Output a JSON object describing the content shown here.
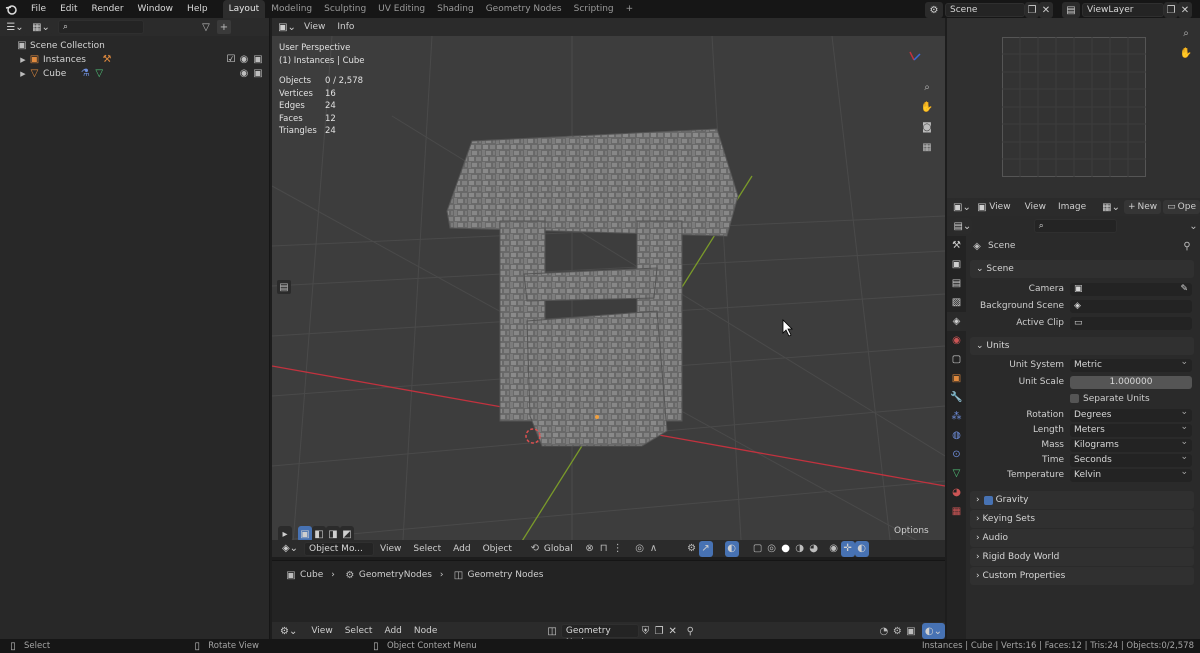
{
  "menu": [
    "File",
    "Edit",
    "Render",
    "Window",
    "Help"
  ],
  "workspaces": [
    "Layout",
    "Modeling",
    "Sculpting",
    "UV Editing",
    "Shading",
    "Geometry Nodes",
    "Scripting"
  ],
  "add_tab": "+",
  "scene_field": "Scene",
  "viewlayer_field": "ViewLayer",
  "outliner": {
    "root": "Scene Collection",
    "items": [
      {
        "label": "Instances"
      },
      {
        "label": "Cube"
      }
    ]
  },
  "viewport_header": {
    "view": "View",
    "info": "Info"
  },
  "viewport": {
    "perspective": "User Perspective",
    "selection": "(1) Instances | Cube",
    "stats": [
      {
        "k": "Objects",
        "v": "0 / 2,578"
      },
      {
        "k": "Vertices",
        "v": "16"
      },
      {
        "k": "Edges",
        "v": "24"
      },
      {
        "k": "Faces",
        "v": "12"
      },
      {
        "k": "Triangles",
        "v": "24"
      }
    ],
    "options_label": "Options"
  },
  "vp_toolbar": {
    "mode": "Object Mo...",
    "view": "View",
    "select": "Select",
    "add": "Add",
    "object": "Object",
    "orientation": "Global"
  },
  "node_editor": {
    "bread": [
      "Cube",
      "GeometryNodes",
      "Geometry Nodes"
    ],
    "view": "View",
    "select": "Select",
    "add": "Add",
    "node": "Node",
    "tree": "Geometry Nodes"
  },
  "image_header": {
    "view": "View",
    "view2": "View",
    "image": "Image",
    "new": "New",
    "open": "Ope"
  },
  "properties": {
    "context": "Scene",
    "panels": {
      "scene": "Scene",
      "camera": "Camera",
      "background_scene": "Background Scene",
      "active_clip": "Active Clip",
      "units": "Units",
      "unit_system_label": "Unit System",
      "unit_system": "Metric",
      "unit_scale_label": "Unit Scale",
      "unit_scale": "1.000000",
      "separate_units": "Separate Units",
      "rotation_label": "Rotation",
      "rotation": "Degrees",
      "length_label": "Length",
      "length": "Meters",
      "mass_label": "Mass",
      "mass": "Kilograms",
      "time_label": "Time",
      "time": "Seconds",
      "temperature_label": "Temperature",
      "temperature": "Kelvin",
      "gravity": "Gravity",
      "keying_sets": "Keying Sets",
      "audio": "Audio",
      "rigid_body_world": "Rigid Body World",
      "custom_properties": "Custom Properties"
    }
  },
  "status": {
    "select": "Select",
    "rotate": "Rotate View",
    "context_menu": "Object Context Menu",
    "info": "Instances | Cube | Verts:16 | Faces:12 | Tris:24 | Objects:0/2,578"
  },
  "colors": {
    "accent": "#4772b3",
    "x_axis": "#c2323e",
    "y_axis": "#7a9a2a"
  }
}
